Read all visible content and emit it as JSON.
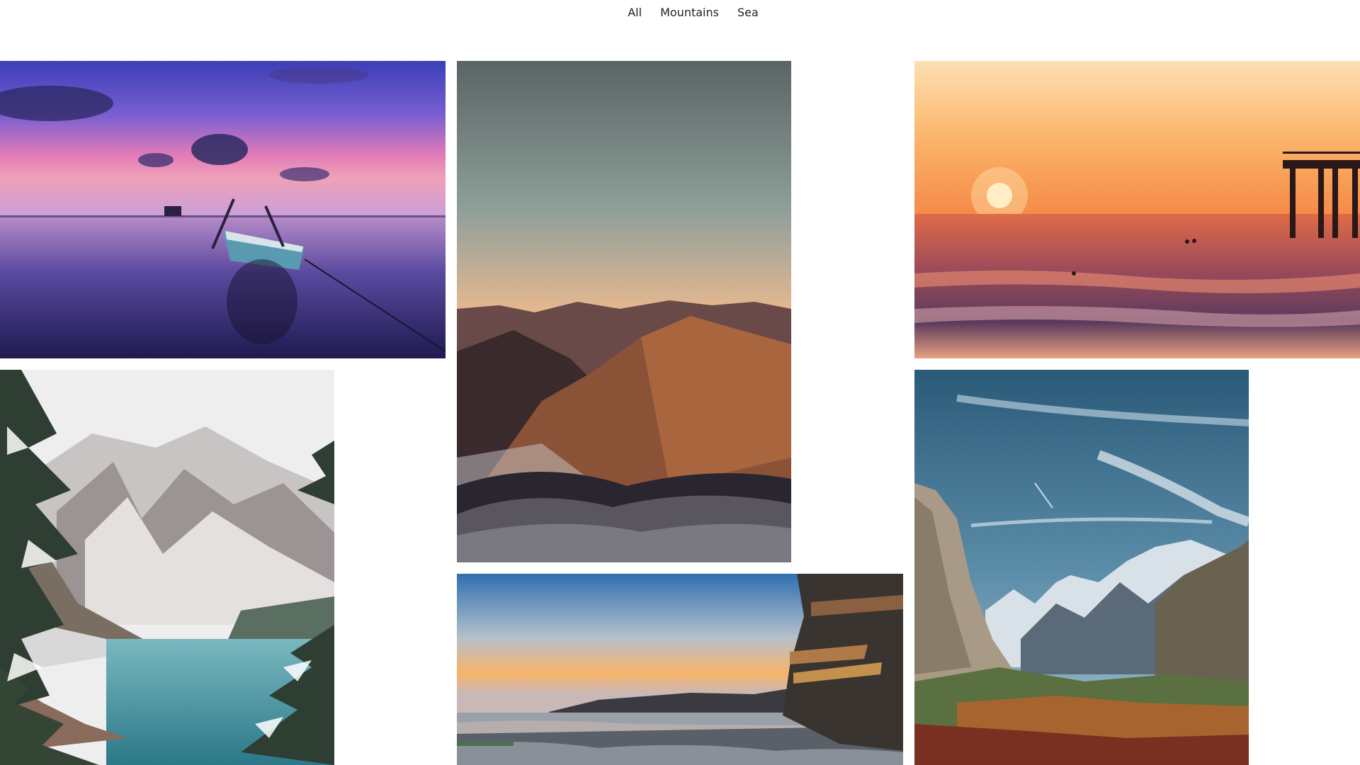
{
  "filters": {
    "all_label": "All",
    "mountains_label": "Mountains",
    "sea_label": "Sea"
  },
  "gallery": {
    "photos": [
      {
        "name": "boat-at-sunset-lake",
        "category": "Sea"
      },
      {
        "name": "mountains-above-clouds",
        "category": "Mountains"
      },
      {
        "name": "sunset-pier-ocean",
        "category": "Sea"
      },
      {
        "name": "snowy-mountain-lake",
        "category": "Mountains"
      },
      {
        "name": "rocky-coast-dawn",
        "category": "Sea"
      },
      {
        "name": "valley-cliffs",
        "category": "Mountains"
      }
    ]
  }
}
